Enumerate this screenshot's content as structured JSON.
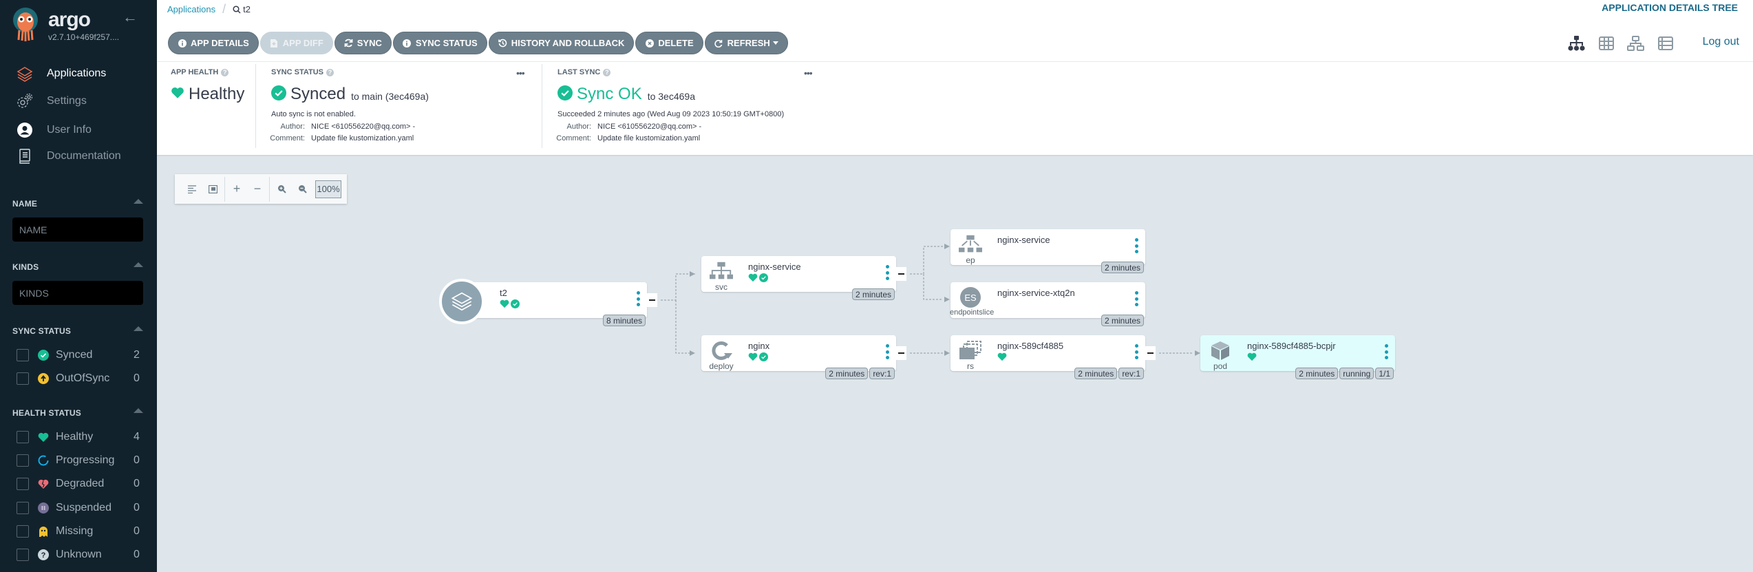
{
  "sidebar": {
    "brand": "argo",
    "version": "v2.7.10+469f257....",
    "nav": [
      {
        "label": "Applications",
        "icon": "layers-icon",
        "active": true
      },
      {
        "label": "Settings",
        "icon": "gears-icon"
      },
      {
        "label": "User Info",
        "icon": "user-circle-icon"
      },
      {
        "label": "Documentation",
        "icon": "book-icon"
      }
    ],
    "filters": {
      "name": {
        "title": "NAME",
        "placeholder": "NAME",
        "value": ""
      },
      "kinds": {
        "title": "KINDS",
        "placeholder": "KINDS",
        "value": ""
      },
      "sync_status": {
        "title": "SYNC STATUS",
        "items": [
          {
            "label": "Synced",
            "count": "2",
            "icon": "check-circle-icon",
            "color": "#18be94"
          },
          {
            "label": "OutOfSync",
            "count": "0",
            "icon": "arrow-up-circle-icon",
            "color": "#f4c030"
          }
        ]
      },
      "health_status": {
        "title": "HEALTH STATUS",
        "items": [
          {
            "label": "Healthy",
            "count": "4",
            "icon": "heart-icon",
            "color": "#18be94"
          },
          {
            "label": "Progressing",
            "count": "0",
            "icon": "circle-notch-icon",
            "color": "#0dadea"
          },
          {
            "label": "Degraded",
            "count": "0",
            "icon": "broken-heart-icon",
            "color": "#e96d76"
          },
          {
            "label": "Suspended",
            "count": "0",
            "icon": "pause-circle-icon",
            "color": "#766f94"
          },
          {
            "label": "Missing",
            "count": "0",
            "icon": "ghost-icon",
            "color": "#f4c030"
          },
          {
            "label": "Unknown",
            "count": "0",
            "icon": "question-circle-icon",
            "color": "#ccd6dd"
          }
        ]
      }
    }
  },
  "header": {
    "breadcrumb": {
      "root": "Applications",
      "current": "t2"
    },
    "title": "APPLICATION DETAILS TREE",
    "buttons": [
      {
        "label": "APP DETAILS",
        "icon": "info-circle-icon"
      },
      {
        "label": "APP DIFF",
        "icon": "file-diff-icon",
        "disabled": true
      },
      {
        "label": "SYNC",
        "icon": "sync-icon"
      },
      {
        "label": "SYNC STATUS",
        "icon": "info-circle-icon"
      },
      {
        "label": "HISTORY AND ROLLBACK",
        "icon": "history-icon"
      },
      {
        "label": "DELETE",
        "icon": "times-circle-icon"
      },
      {
        "label": "REFRESH",
        "icon": "redo-icon",
        "dropdown": true
      }
    ],
    "view_modes": [
      "tree-view-icon",
      "pods-view-icon",
      "network-view-icon",
      "list-view-icon"
    ],
    "logout": "Log out"
  },
  "status": {
    "app_health": {
      "title": "APP HEALTH",
      "value": "Healthy"
    },
    "sync_status": {
      "title": "SYNC STATUS",
      "value": "Synced",
      "sub": "to main (3ec469a)",
      "note": "Auto sync is not enabled.",
      "author_label": "Author:",
      "author": "NICE <610556220@qq.com> -",
      "comment_label": "Comment:",
      "comment": "Update file kustomization.yaml"
    },
    "last_sync": {
      "title": "LAST SYNC",
      "value": "Sync OK",
      "sub": "to 3ec469a",
      "note": "Succeeded 2 minutes ago (Wed Aug 09 2023 10:50:19 GMT+0800)",
      "author_label": "Author:",
      "author": "NICE <610556220@qq.com> -",
      "comment_label": "Comment:",
      "comment": "Update file kustomization.yaml"
    }
  },
  "graph_toolbar": {
    "zoom": "100%"
  },
  "nodes": {
    "app": {
      "name": "t2",
      "tags": [
        "8 minutes"
      ]
    },
    "svc": {
      "name": "nginx-service",
      "kind": "svc",
      "tags": [
        "2 minutes"
      ]
    },
    "deploy": {
      "name": "nginx",
      "kind": "deploy",
      "tags": [
        "2 minutes",
        "rev:1"
      ]
    },
    "ep": {
      "name": "nginx-service",
      "kind": "ep",
      "tags": [
        "2 minutes"
      ]
    },
    "es": {
      "name": "nginx-service-xtq2n",
      "kind": "endpointslice",
      "badge": "ES",
      "tags": [
        "2 minutes"
      ]
    },
    "rs": {
      "name": "nginx-589cf4885",
      "kind": "rs",
      "tags": [
        "2 minutes",
        "rev:1"
      ]
    },
    "pod": {
      "name": "nginx-589cf4885-bcpjr",
      "kind": "pod",
      "tags": [
        "2 minutes",
        "running",
        "1/1"
      ]
    }
  }
}
